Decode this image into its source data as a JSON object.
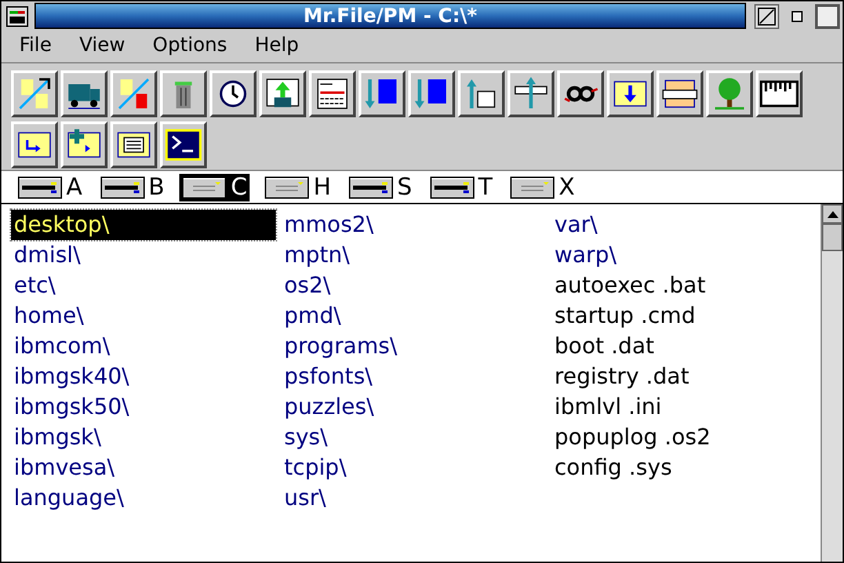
{
  "window": {
    "title": "Mr.File/PM - C:\\*"
  },
  "menu": [
    "File",
    "View",
    "Options",
    "Help"
  ],
  "drives": [
    {
      "letter": "A",
      "kind": "floppy",
      "selected": false
    },
    {
      "letter": "B",
      "kind": "floppy",
      "selected": false
    },
    {
      "letter": "C",
      "kind": "disk",
      "selected": true
    },
    {
      "letter": "H",
      "kind": "disk",
      "selected": false
    },
    {
      "letter": "S",
      "kind": "floppy",
      "selected": false
    },
    {
      "letter": "T",
      "kind": "floppy",
      "selected": false
    },
    {
      "letter": "X",
      "kind": "disk",
      "selected": false
    }
  ],
  "files": [
    {
      "name": "desktop\\",
      "kind": "dir",
      "selected": true
    },
    {
      "name": "dmisl\\",
      "kind": "dir",
      "selected": false
    },
    {
      "name": "etc\\",
      "kind": "dir",
      "selected": false
    },
    {
      "name": "home\\",
      "kind": "dir",
      "selected": false
    },
    {
      "name": "ibmcom\\",
      "kind": "dir",
      "selected": false
    },
    {
      "name": "ibmgsk40\\",
      "kind": "dir",
      "selected": false
    },
    {
      "name": "ibmgsk50\\",
      "kind": "dir",
      "selected": false
    },
    {
      "name": "ibmgsk\\",
      "kind": "dir",
      "selected": false
    },
    {
      "name": "ibmvesa\\",
      "kind": "dir",
      "selected": false
    },
    {
      "name": "language\\",
      "kind": "dir",
      "selected": false
    },
    {
      "name": "mmos2\\",
      "kind": "dir",
      "selected": false
    },
    {
      "name": "mptn\\",
      "kind": "dir",
      "selected": false
    },
    {
      "name": "os2\\",
      "kind": "dir",
      "selected": false
    },
    {
      "name": "pmd\\",
      "kind": "dir",
      "selected": false
    },
    {
      "name": "programs\\",
      "kind": "dir",
      "selected": false
    },
    {
      "name": "psfonts\\",
      "kind": "dir",
      "selected": false
    },
    {
      "name": "puzzles\\",
      "kind": "dir",
      "selected": false
    },
    {
      "name": "sys\\",
      "kind": "dir",
      "selected": false
    },
    {
      "name": "tcpip\\",
      "kind": "dir",
      "selected": false
    },
    {
      "name": "usr\\",
      "kind": "dir",
      "selected": false
    },
    {
      "name": "var\\",
      "kind": "dir",
      "selected": false
    },
    {
      "name": "warp\\",
      "kind": "dir",
      "selected": false
    },
    {
      "name": "autoexec .bat",
      "kind": "file",
      "selected": false
    },
    {
      "name": "startup .cmd",
      "kind": "file",
      "selected": false
    },
    {
      "name": "boot .dat",
      "kind": "file",
      "selected": false
    },
    {
      "name": "registry .dat",
      "kind": "file",
      "selected": false
    },
    {
      "name": "ibmlvl .ini",
      "kind": "file",
      "selected": false
    },
    {
      "name": "popuplog .os2",
      "kind": "file",
      "selected": false
    },
    {
      "name": "config .sys",
      "kind": "file",
      "selected": false
    }
  ]
}
